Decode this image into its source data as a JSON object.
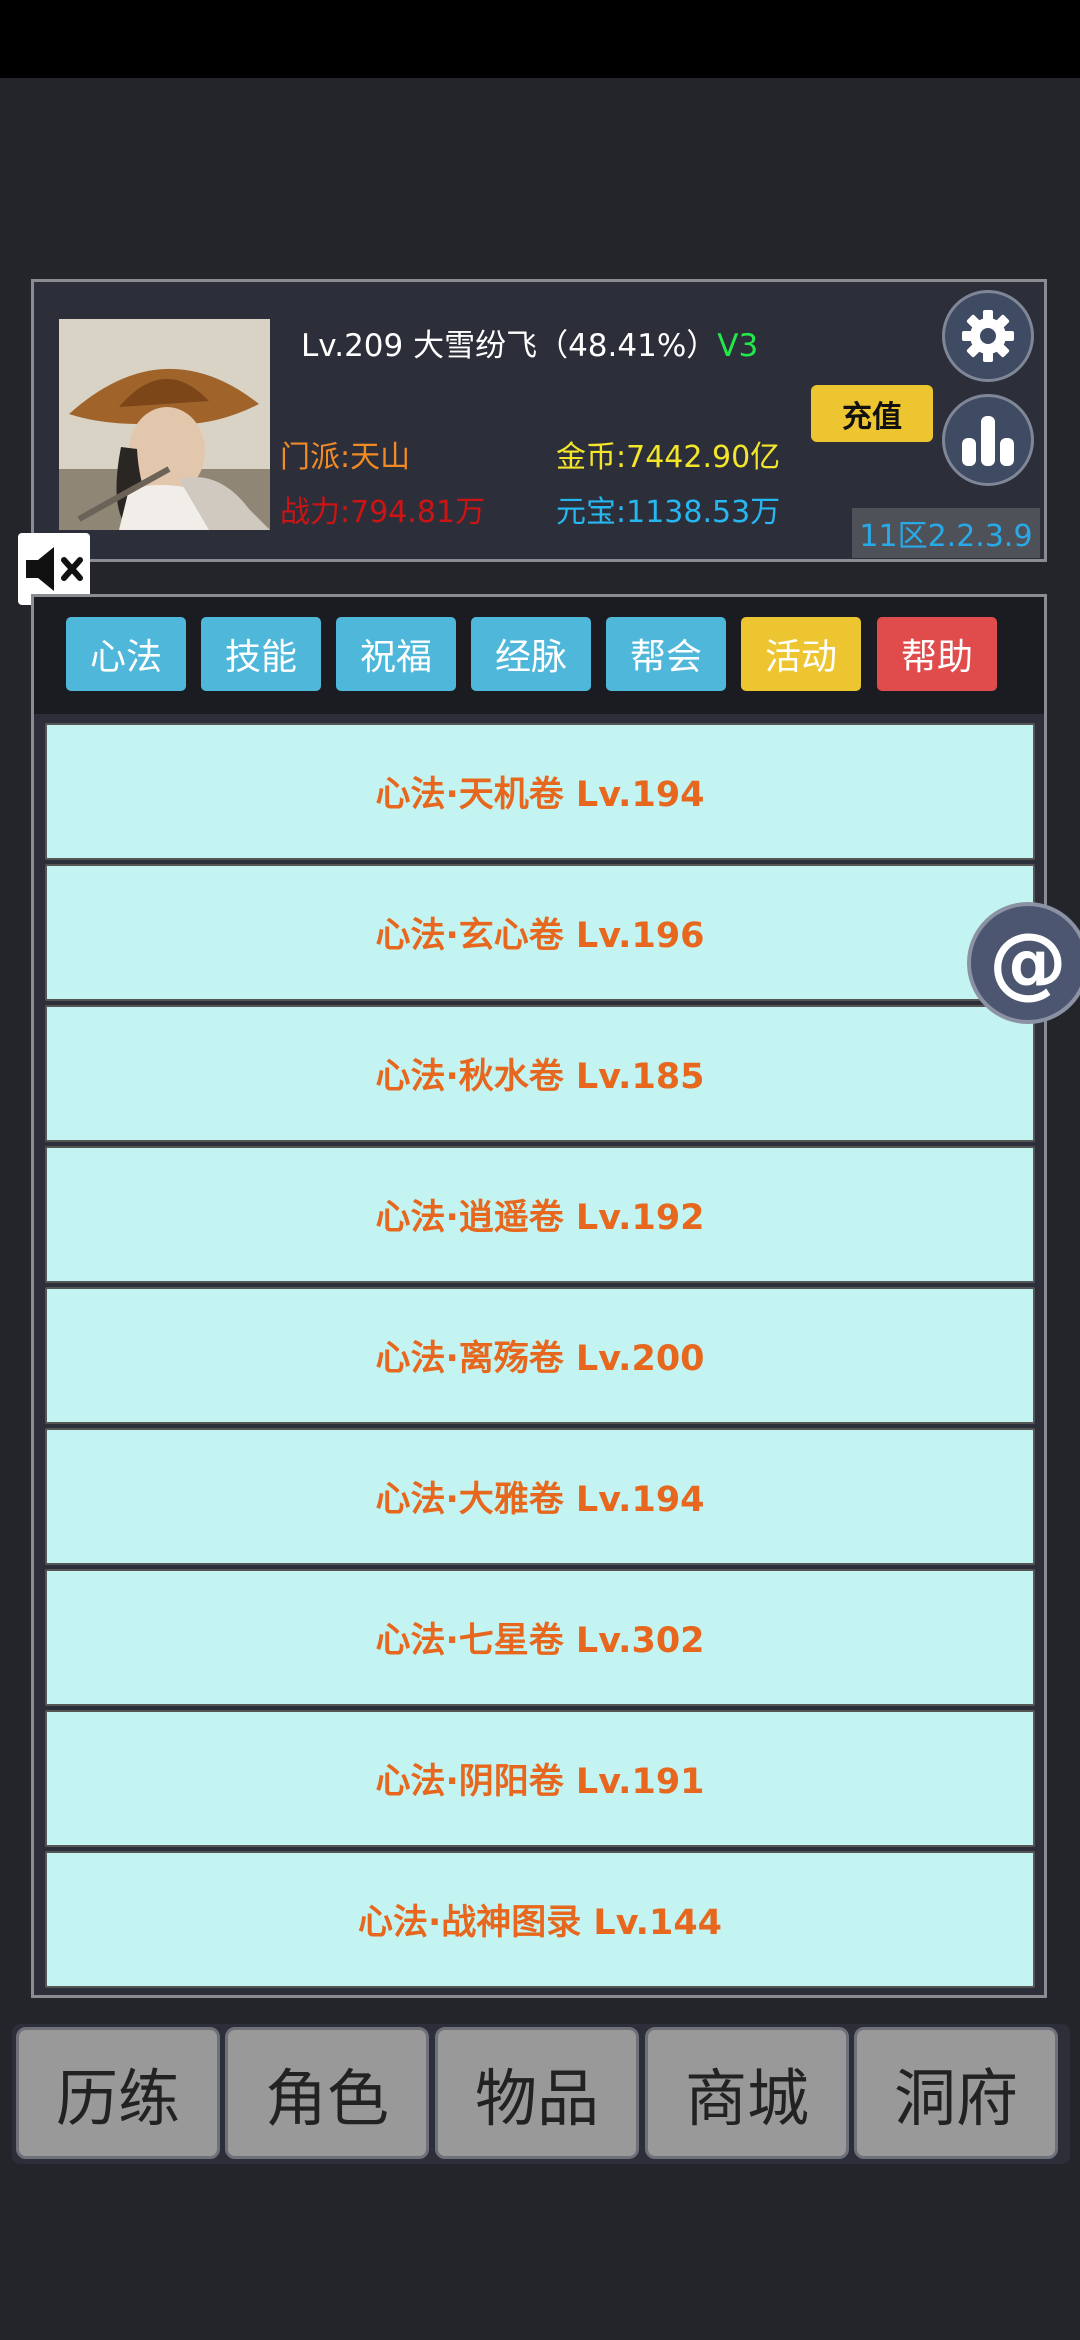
{
  "profile": {
    "level_name": "Lv.209 大雪纷飞（48.41%）",
    "vip": "V3",
    "sect": "门派:天山",
    "power": "战力:794.81万",
    "gold": "金币:7442.90亿",
    "ingot": "元宝:1138.53万",
    "recharge_label": "充值",
    "version": "11区2.2.3.9"
  },
  "tabs": [
    {
      "label": "心法",
      "color": "#4fb7d9"
    },
    {
      "label": "技能",
      "color": "#4fb7d9"
    },
    {
      "label": "祝福",
      "color": "#4fb7d9"
    },
    {
      "label": "经脉",
      "color": "#4fb7d9"
    },
    {
      "label": "帮会",
      "color": "#4fb7d9"
    },
    {
      "label": "活动",
      "color": "#ecc531"
    },
    {
      "label": "帮助",
      "color": "#e04c4c"
    }
  ],
  "skills": [
    "心法·天机卷 Lv.194",
    "心法·玄心卷 Lv.196",
    "心法·秋水卷 Lv.185",
    "心法·逍遥卷 Lv.192",
    "心法·离殇卷 Lv.200",
    "心法·大雅卷 Lv.194",
    "心法·七星卷 Lv.302",
    "心法·阴阳卷 Lv.191",
    "心法·战神图录 Lv.144"
  ],
  "float_button": "@",
  "nav": [
    "历练",
    "角色",
    "物品",
    "商城",
    "洞府"
  ],
  "icons": {
    "settings": "gear-icon",
    "stats": "bar-chart-icon",
    "mute": "speaker-muted-icon"
  }
}
